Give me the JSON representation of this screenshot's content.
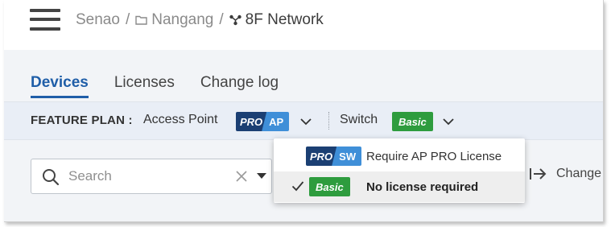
{
  "breadcrumb": {
    "org": "Senao",
    "separator": "/",
    "site": "Nangang",
    "network": "8F Network"
  },
  "tabs": [
    {
      "label": "Devices",
      "active": true
    },
    {
      "label": "Licenses",
      "active": false
    },
    {
      "label": "Change log",
      "active": false
    }
  ],
  "feature_plan": {
    "label": "FEATURE PLAN :",
    "access_point_label": "Access Point",
    "ap_badge": {
      "left": "PRO",
      "right": "AP"
    },
    "switch_label": "Switch",
    "switch_badge": "Basic"
  },
  "search": {
    "placeholder": "Search",
    "value": ""
  },
  "change_button": {
    "label": "Change"
  },
  "dropdown": {
    "items": [
      {
        "badge_left": "PRO",
        "badge_right": "SW",
        "label": "Require AP PRO License",
        "selected": false
      },
      {
        "badge": "Basic",
        "label": "No license required",
        "selected": true
      }
    ]
  },
  "colors": {
    "accent": "#1f5ea8",
    "pro_dark": "#1b3f73",
    "pro_light": "#3f8fd8",
    "basic_green": "#2e9c3e",
    "plan_bar_bg": "#e9eef6"
  },
  "icons": [
    "menu-icon",
    "folder-icon",
    "network-icon",
    "chevron-down-icon",
    "search-icon",
    "close-icon",
    "caret-down-icon",
    "arrow-to-line-icon",
    "check-icon"
  ]
}
